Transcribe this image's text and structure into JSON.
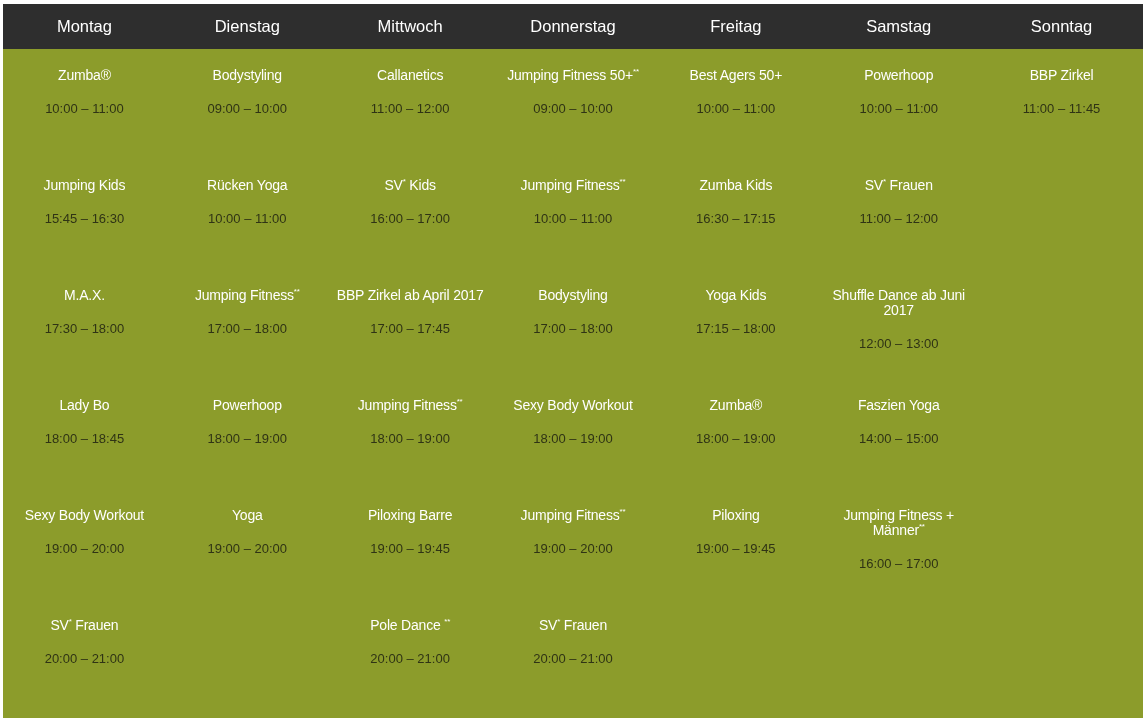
{
  "days": [
    {
      "name": "Montag",
      "sessions": [
        {
          "title": "Zumba®",
          "time": "10:00 – 11:00"
        },
        {
          "title": "Jumping Kids",
          "time": "15:45 – 16:30"
        },
        {
          "title": "M.A.X.",
          "time": "17:30 – 18:00"
        },
        {
          "title": "Lady Bo",
          "time": "18:00 – 18:45"
        },
        {
          "title": "Sexy Body Workout",
          "time": "19:00 – 20:00"
        },
        {
          "title": "SV$^{*}$ Frauen",
          "time": "20:00 – 21:00"
        }
      ]
    },
    {
      "name": "Dienstag",
      "sessions": [
        {
          "title": "Bodystyling",
          "time": "09:00 – 10:00"
        },
        {
          "title": "Rücken Yoga",
          "time": "10:00 – 11:00"
        },
        {
          "title": "Jumping Fitness$^{**}$",
          "time": "17:00 – 18:00"
        },
        {
          "title": "Powerhoop",
          "time": "18:00 – 19:00"
        },
        {
          "title": "Yoga",
          "time": "19:00 – 20:00"
        }
      ]
    },
    {
      "name": "Mittwoch",
      "sessions": [
        {
          "title": "Callanetics",
          "time": "11:00 – 12:00"
        },
        {
          "title": "SV$^{*}$ Kids",
          "time": "16:00 – 17:00"
        },
        {
          "title": "BBP Zirkel ab April 2017",
          "time": "17:00 – 17:45"
        },
        {
          "title": "Jumping Fitness$^{**}$",
          "time": "18:00 – 19:00"
        },
        {
          "title": "Piloxing Barre",
          "time": "19:00 – 19:45"
        },
        {
          "title": "Pole Dance $^{**}$",
          "time": "20:00 – 21:00"
        }
      ]
    },
    {
      "name": "Donnerstag",
      "sessions": [
        {
          "title": "Jumping Fitness 50+$^{**}$",
          "time": "09:00 – 10:00"
        },
        {
          "title": "Jumping Fitness$^{**}$",
          "time": "10:00 – 11:00"
        },
        {
          "title": "Bodystyling",
          "time": "17:00 – 18:00"
        },
        {
          "title": "Sexy Body Workout",
          "time": "18:00 – 19:00"
        },
        {
          "title": "Jumping Fitness$^{**}$",
          "time": "19:00 – 20:00"
        },
        {
          "title": "SV$^{*}$ Frauen",
          "time": "20:00 – 21:00"
        }
      ]
    },
    {
      "name": "Freitag",
      "sessions": [
        {
          "title": "Best Agers 50+",
          "time": "10:00 – 11:00"
        },
        {
          "title": "Zumba Kids",
          "time": "16:30 – 17:15"
        },
        {
          "title": "Yoga Kids",
          "time": "17:15 – 18:00"
        },
        {
          "title": "Zumba®",
          "time": "18:00 – 19:00"
        },
        {
          "title": "Piloxing",
          "time": "19:00 – 19:45"
        }
      ]
    },
    {
      "name": "Samstag",
      "sessions": [
        {
          "title": "Powerhoop",
          "time": "10:00 – 11:00"
        },
        {
          "title": "SV$^{*}$ Frauen",
          "time": "11:00 – 12:00"
        },
        {
          "title": "Shuffle Dance ab Juni 2017",
          "time": "12:00 – 13:00"
        },
        {
          "title": "Faszien Yoga",
          "time": "14:00 – 15:00"
        },
        {
          "title": "Jumping Fitness + Männer$^{**}$",
          "time": "16:00 – 17:00"
        }
      ]
    },
    {
      "name": "Sonntag",
      "sessions": [
        {
          "title": "BBP Zirkel",
          "time": "11:00 – 11:45"
        }
      ]
    }
  ]
}
